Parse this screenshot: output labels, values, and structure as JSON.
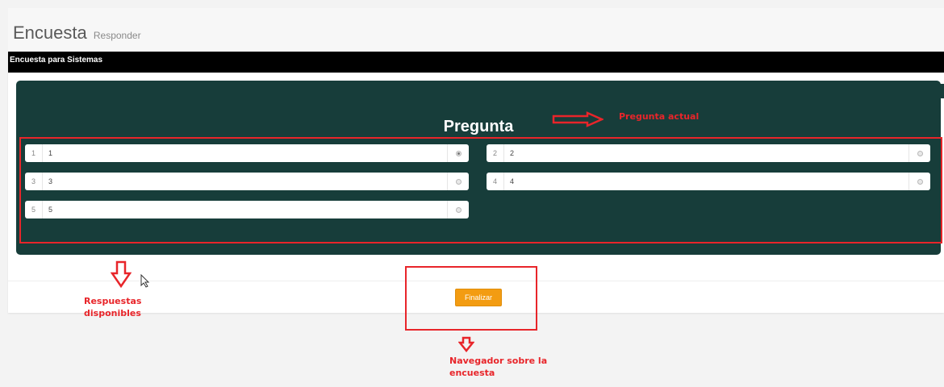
{
  "header": {
    "title": "Encuesta",
    "subtitle": "Responder"
  },
  "panel": {
    "heading": "Encuesta para Sistemas"
  },
  "question": {
    "title": "Pregunta",
    "answers": [
      {
        "number": "1",
        "text": "1",
        "selected": true
      },
      {
        "number": "2",
        "text": "2",
        "selected": false
      },
      {
        "number": "3",
        "text": "3",
        "selected": false
      },
      {
        "number": "4",
        "text": "4",
        "selected": false
      },
      {
        "number": "5",
        "text": "5",
        "selected": false
      }
    ]
  },
  "footer": {
    "finish_label": "Finalizar"
  },
  "annotations": {
    "current_question": "Pregunta actual",
    "available_answers_line1": "Respuestas",
    "available_answers_line2": "disponibles",
    "navigator_line1": "Navegador sobre la",
    "navigator_line2": "encuesta",
    "color": "#e8252a"
  },
  "theme": {
    "accent": "#173d3a",
    "button": "#f39c12"
  }
}
